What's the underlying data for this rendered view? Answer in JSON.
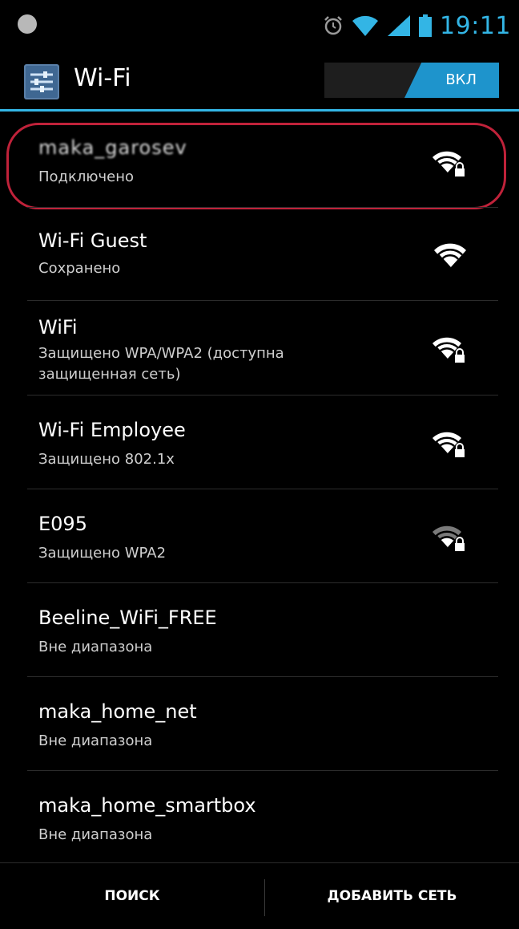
{
  "status_bar": {
    "time": "19:11",
    "accent_color": "#33b5e5"
  },
  "action_bar": {
    "title": "Wi-Fi",
    "toggle_label": "ВКЛ",
    "toggle_state": "on"
  },
  "networks": [
    {
      "name": "maka_garosev",
      "status": "Подключено",
      "secured": true,
      "highlighted": true
    },
    {
      "name": "Wi-Fi Guest",
      "status": "Сохранено",
      "secured": false
    },
    {
      "name": "WiFi",
      "status": "Защищено WPA/WPA2 (доступна защищенная сеть)",
      "secured": true
    },
    {
      "name": "Wi-Fi Employee",
      "status": "Защищено 802.1x",
      "secured": true
    },
    {
      "name": "E095",
      "status": "Защищено WPA2",
      "secured": true
    },
    {
      "name": "Beeline_WiFi_FREE",
      "status": "Вне диапазона"
    },
    {
      "name": "maka_home_net",
      "status": "Вне диапазона"
    },
    {
      "name": "maka_home_smartbox",
      "status": "Вне диапазона"
    }
  ],
  "bottom_bar": {
    "search_label": "ПОИСК",
    "add_network_label": "ДОБАВИТЬ СЕТЬ"
  }
}
